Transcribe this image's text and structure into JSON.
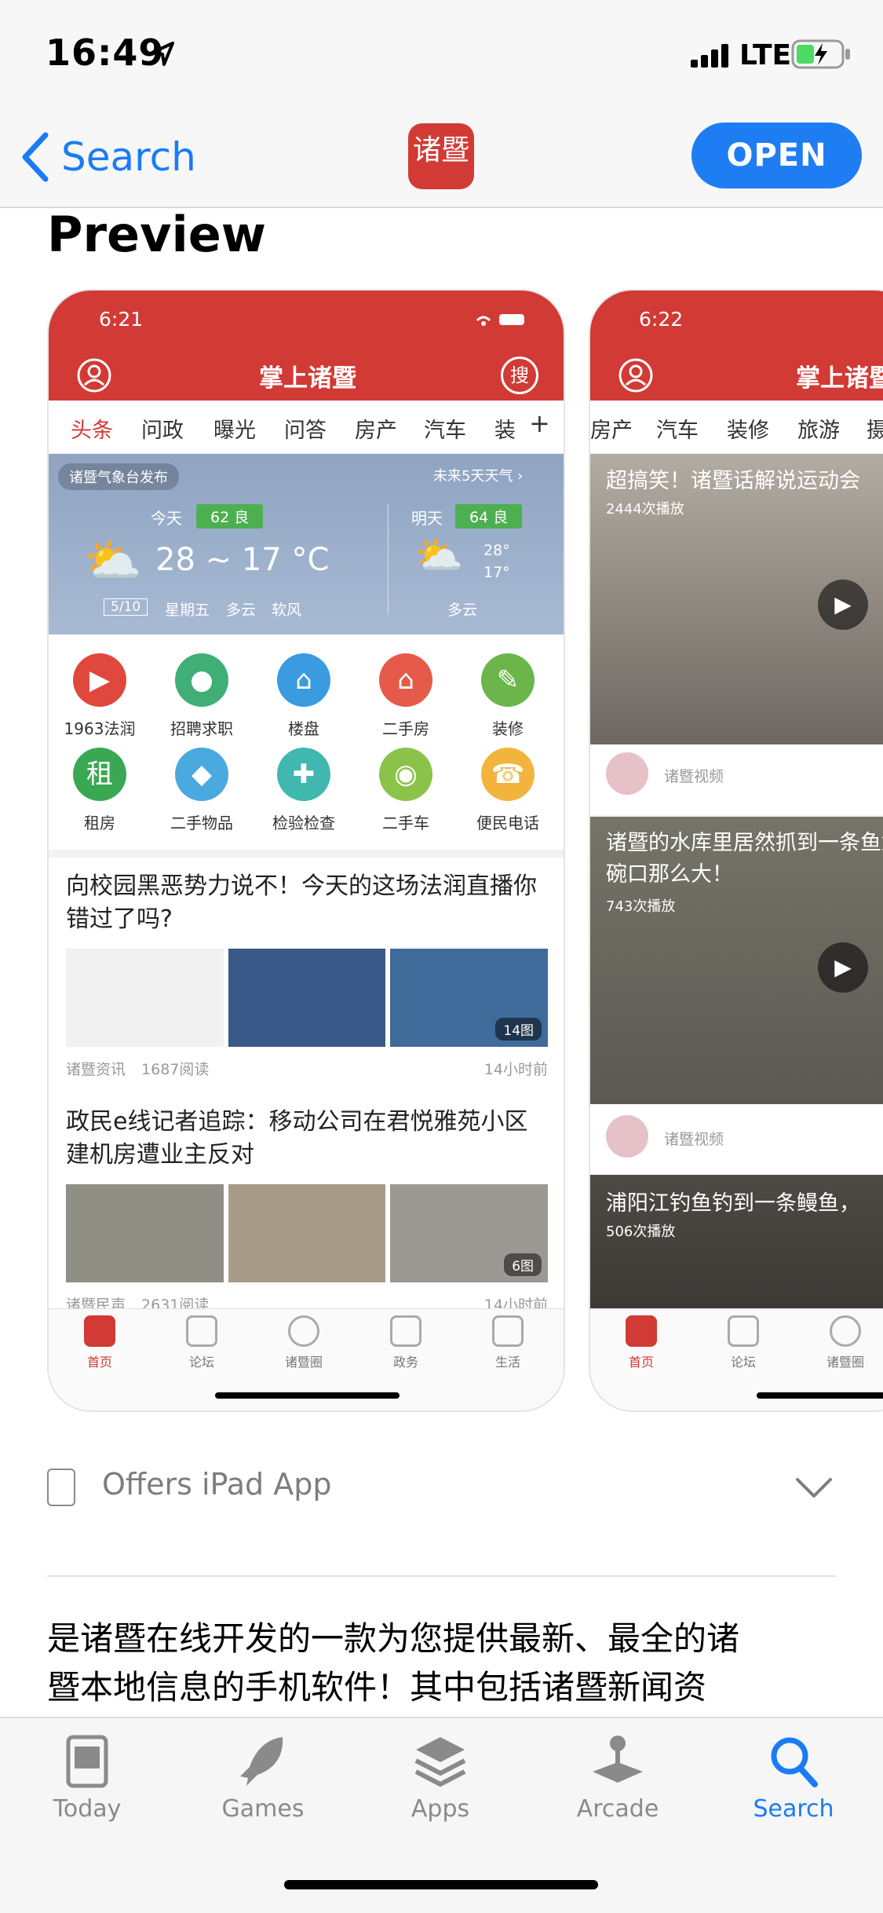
{
  "status": {
    "time": "16:49",
    "network": "LTE"
  },
  "nav": {
    "back_label": "Search",
    "open_label": "OPEN",
    "app_icon_text": "诸暨"
  },
  "preview": {
    "title": "Preview"
  },
  "shot1": {
    "time": "6:21",
    "title": "掌上诸暨",
    "search_char": "搜",
    "tabs": [
      "头条",
      "问政",
      "曝光",
      "问答",
      "房产",
      "汽车",
      "装"
    ],
    "weather": {
      "publisher": "诸暨气象台发布",
      "forecast_link": "未来5天天气",
      "today": "今天",
      "today_aqi": "62 良",
      "today_temp": "28 ~ 17 °C",
      "date": "5/10",
      "weekday": "星期五",
      "cond": "多云",
      "wind": "软风",
      "tomorrow": "明天",
      "tomorrow_aqi": "64 良",
      "tomorrow_high": "28°",
      "tomorrow_low": "17°",
      "tomorrow_cond": "多云"
    },
    "grid": [
      {
        "label": "1963法润",
        "color": "#e0483d",
        "glyph": "▶"
      },
      {
        "label": "招聘求职",
        "color": "#3fae77",
        "glyph": "●"
      },
      {
        "label": "楼盘",
        "color": "#3a9be0",
        "glyph": "⌂"
      },
      {
        "label": "二手房",
        "color": "#e65a4a",
        "glyph": "⌂"
      },
      {
        "label": "装修",
        "color": "#6cb54a",
        "glyph": "✎"
      },
      {
        "label": "租房",
        "color": "#3aa853",
        "glyph": "租"
      },
      {
        "label": "二手物品",
        "color": "#4aa9de",
        "glyph": "◆"
      },
      {
        "label": "检验检查",
        "color": "#40b8b0",
        "glyph": "✚"
      },
      {
        "label": "二手车",
        "color": "#8bc34a",
        "glyph": "◉"
      },
      {
        "label": "便民电话",
        "color": "#f2b43c",
        "glyph": "☎"
      }
    ],
    "news": [
      {
        "title": "向校园黑恶势力说不！今天的这场法润直播你错过了吗?",
        "source": "诸暨资讯",
        "reads": "1687阅读",
        "time": "14小时前",
        "count": "14图"
      },
      {
        "title": "政民e线记者追踪：移动公司在君悦雅苑小区建机房遭业主反对",
        "source": "诸暨民声",
        "reads": "2631阅读",
        "time": "14小时前",
        "count": "6图"
      }
    ],
    "footer": [
      "首页",
      "论坛",
      "诸暨圈",
      "政务",
      "生活"
    ]
  },
  "shot2": {
    "time": "6:22",
    "title": "掌上诸暨",
    "tabs": [
      "房产",
      "汽车",
      "装修",
      "旅游",
      "摄"
    ],
    "videos": [
      {
        "title": "超搞笑！诸暨话解说运动会",
        "plays": "2444次播放",
        "author": "诸暨视频"
      },
      {
        "title": "诸暨的水库里居然抓到一条鱼鳞有碗口那么大！",
        "plays": "743次播放",
        "author": "诸暨视频"
      },
      {
        "title": "浦阳江钓鱼钓到一条鳗鱼，",
        "plays": "506次播放"
      }
    ],
    "footer": [
      "首页",
      "论坛",
      "诸暨圈"
    ]
  },
  "ipad": {
    "label": "Offers iPad App"
  },
  "description": {
    "line1": "是诸暨在线开发的一款为您提供最新、最全的诸",
    "line2": "暨本地信息的手机软件！其中包括诸暨新闻资"
  },
  "tabbar": {
    "items": [
      {
        "label": "Today",
        "icon": "today-icon"
      },
      {
        "label": "Games",
        "icon": "rocket-icon"
      },
      {
        "label": "Apps",
        "icon": "layers-icon"
      },
      {
        "label": "Arcade",
        "icon": "joystick-icon"
      },
      {
        "label": "Search",
        "icon": "search-icon"
      }
    ],
    "active": "Search",
    "active_color": "#1a7cf5"
  }
}
